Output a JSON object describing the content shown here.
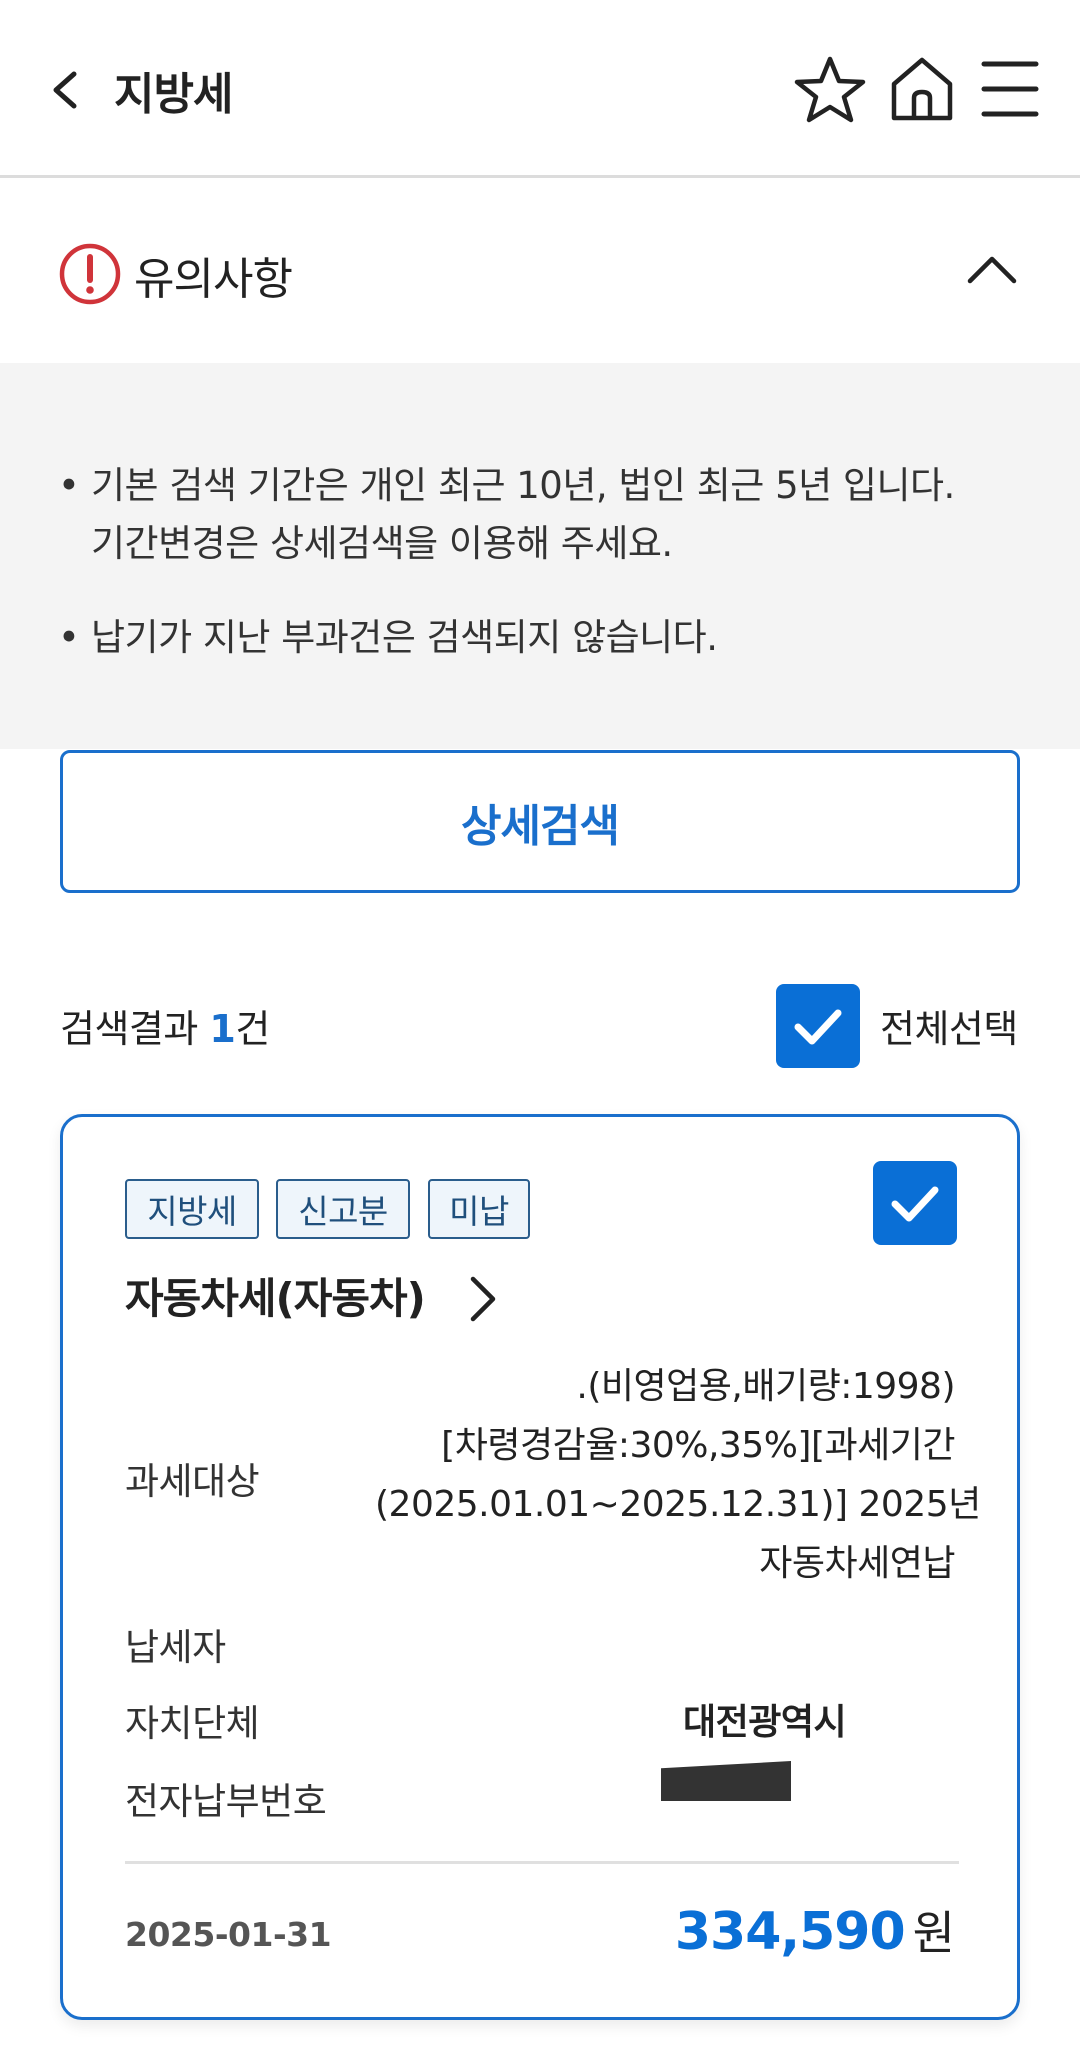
{
  "header": {
    "title": "지방세",
    "icons": [
      "back-arrow-icon",
      "star-icon",
      "home-icon",
      "menu-icon"
    ]
  },
  "notice": {
    "title": "유의사항",
    "bullet": "•",
    "items": [
      {
        "line1": "기본 검색 기간은 개인 최근 10년, 법인 최근 5년 입니다.",
        "line2": "기간변경은 상세검색을 이용해 주세요."
      },
      {
        "line1": "납기가 지난 부과건은 검색되지 않습니다."
      }
    ]
  },
  "search": {
    "detail_button": "상세검색"
  },
  "results": {
    "count_prefix": "검색결과 ",
    "count": "1",
    "count_suffix": "건",
    "select_all_label": "전체선택",
    "select_all_checked": true
  },
  "card": {
    "badges": [
      "지방세",
      "신고분",
      "미납"
    ],
    "checked": true,
    "tax_name": "자동차세(자동차)",
    "rows": {
      "target_label": "과세대상",
      "target_lines": [
        ".(비영업용,배기량:1998)",
        "[차령경감율:30%,35%][과세기간",
        "(2025.01.01~2025.12.31)] 2025년",
        "자동차세연납"
      ],
      "taxpayer_label": "납세자",
      "region_label": "자치단체",
      "region_value": "대전광역시",
      "epay_label": "전자납부번호"
    },
    "due_date": "2025-01-31",
    "amount": "334,590",
    "amount_unit": "원"
  },
  "colors": {
    "accent": "#1a6fcc",
    "checkbox": "#0a6fd6",
    "alert": "#d0343a",
    "notice_bg": "#f4f4f4"
  }
}
